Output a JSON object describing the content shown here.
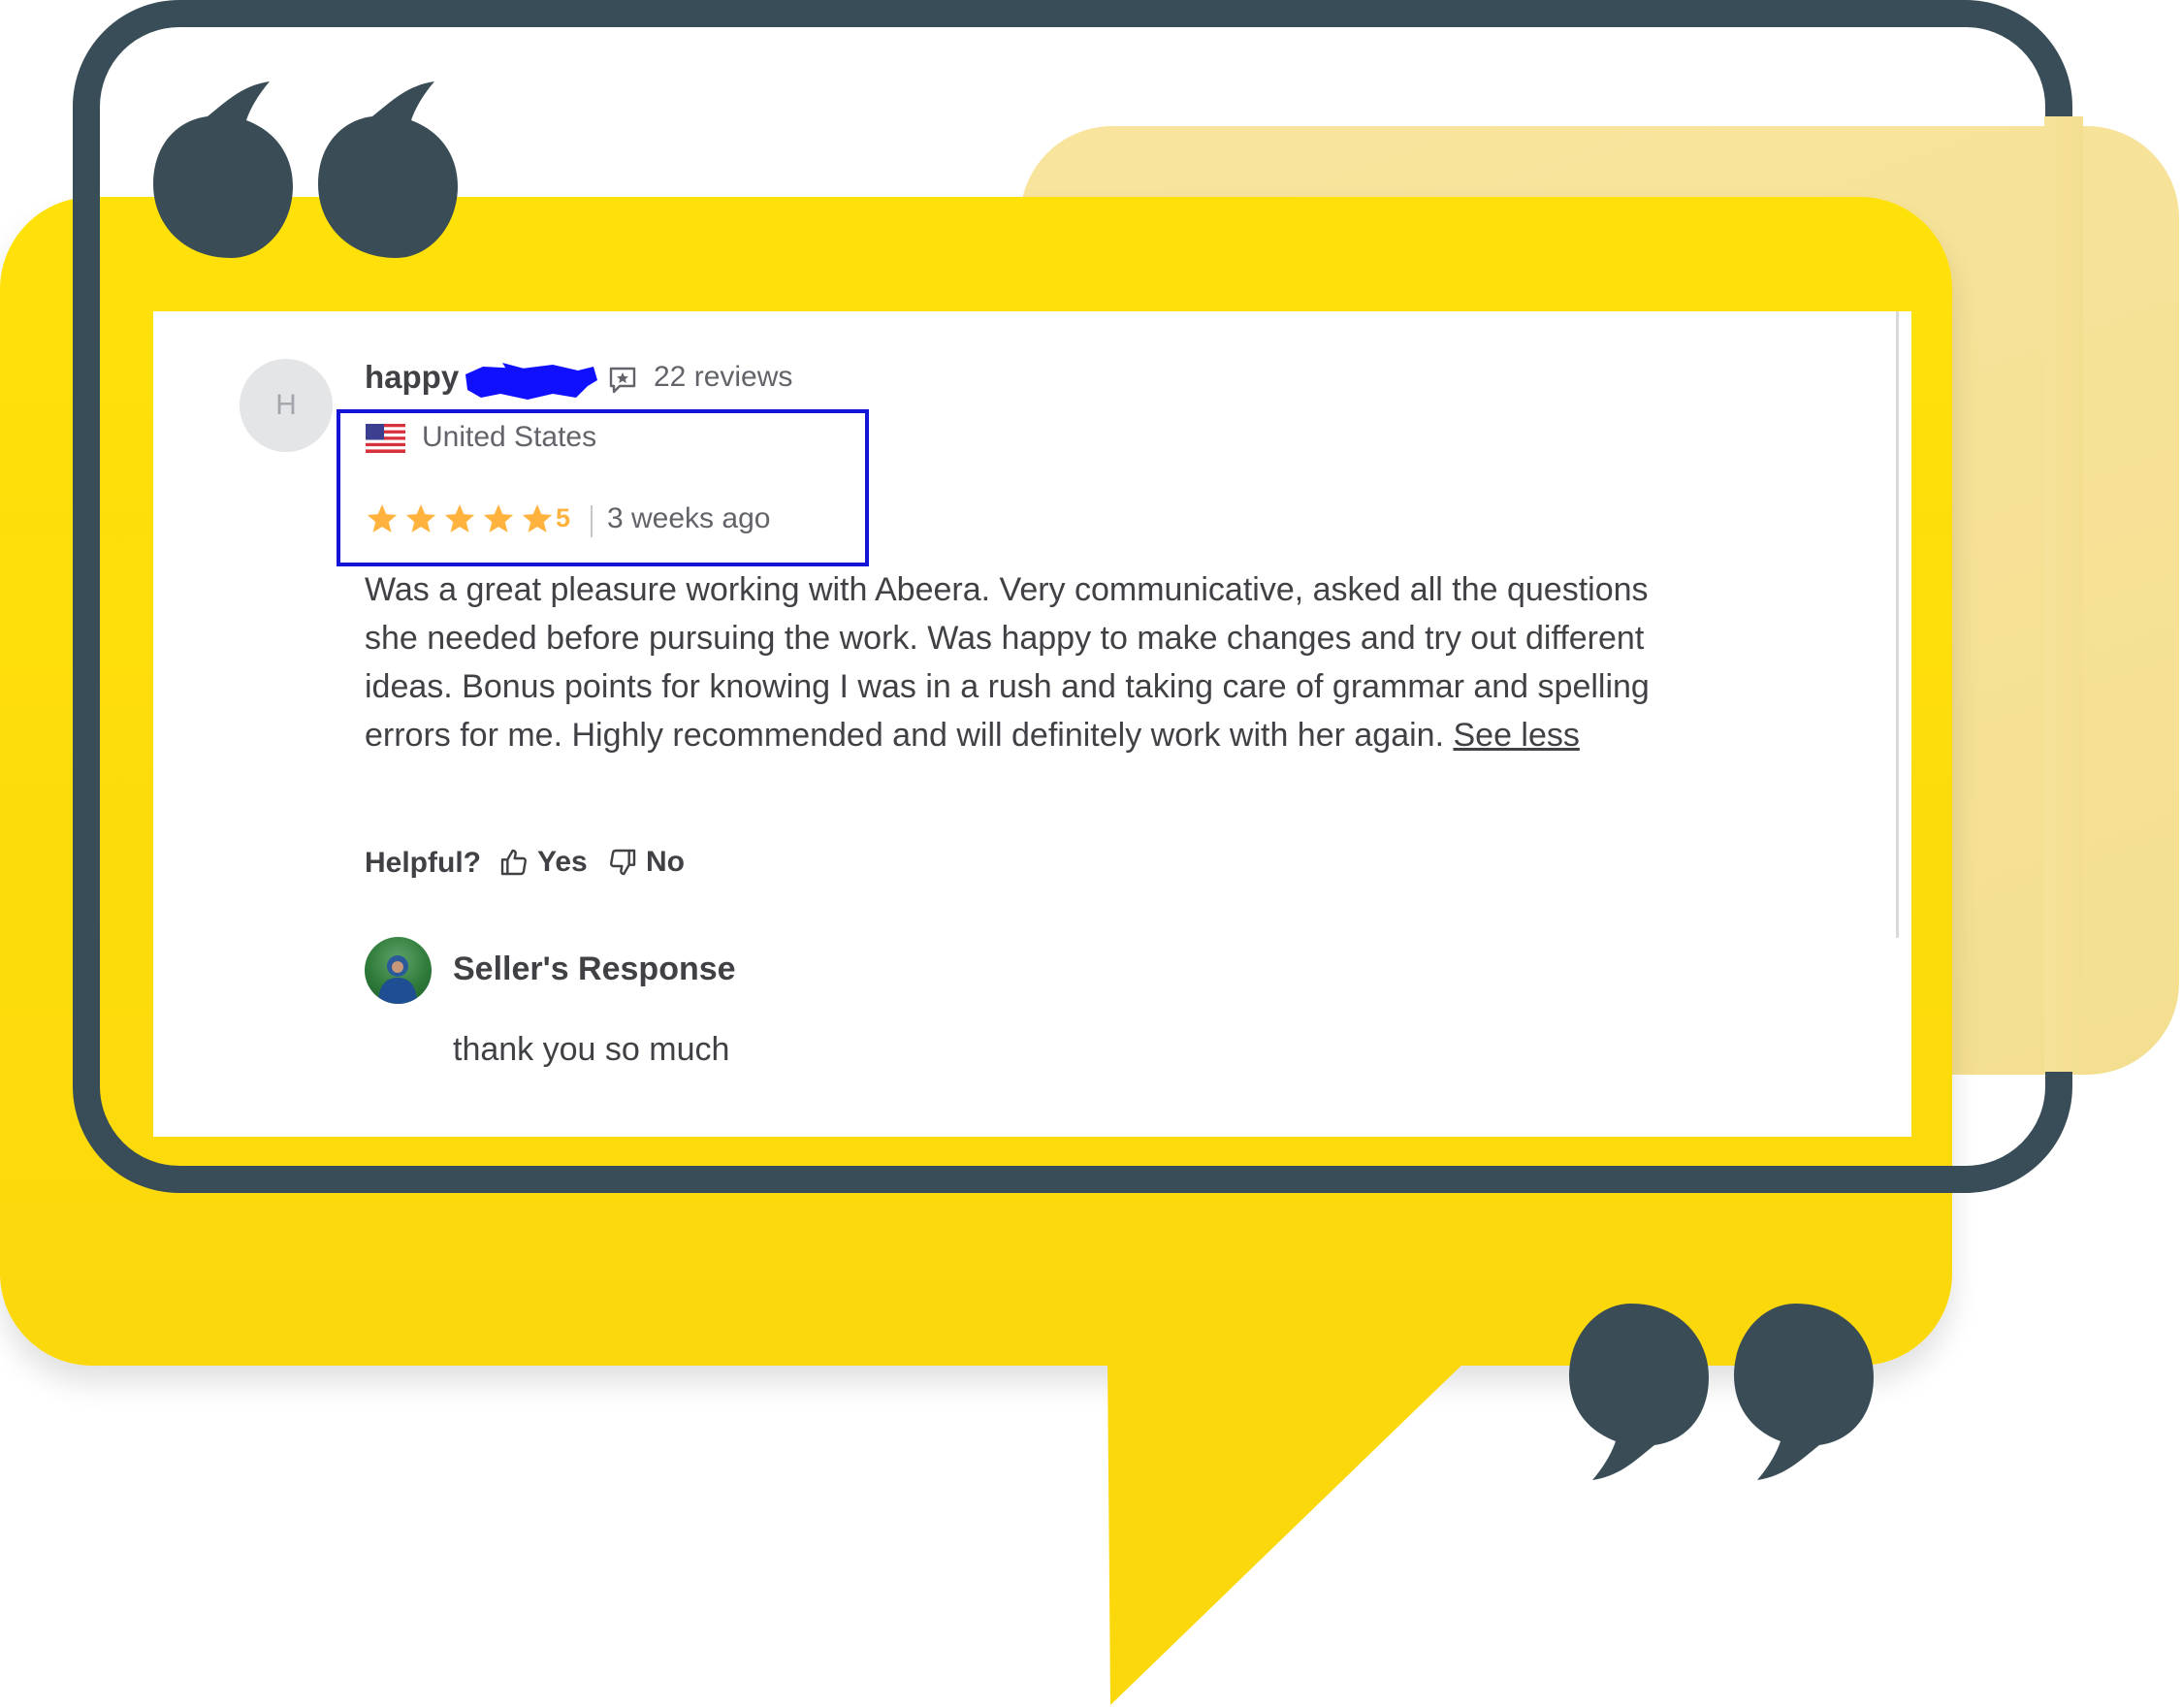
{
  "review": {
    "avatar_initial": "H",
    "username": "happy",
    "reviews_count": "22 reviews",
    "country": "United States",
    "rating": "5",
    "time_ago": "3 weeks ago",
    "body": "Was a great pleasure working with Abeera. Very communicative, asked all the questions she needed before pursuing the work. Was happy to make changes and try out different ideas. Bonus points for knowing I was in a rush and taking care of grammar and spelling errors for me. Highly recommended and will definitely work with her again.",
    "see_less": "See less",
    "stars": 5
  },
  "feedback": {
    "helpful_label": "Helpful?",
    "yes_label": "Yes",
    "no_label": "No"
  },
  "seller_response": {
    "title": "Seller's Response",
    "text": "thank you so much"
  },
  "colors": {
    "accent_yellow": "#ffdd00",
    "frame": "#384d57",
    "star": "#ffb33e",
    "highlight_box": "#1414d8",
    "redaction": "#1010ff"
  },
  "icons": [
    "quote-open-icon",
    "quote-close-icon",
    "reviews-icon",
    "us-flag-icon",
    "star-icon",
    "thumbs-up-icon",
    "thumbs-down-icon"
  ]
}
